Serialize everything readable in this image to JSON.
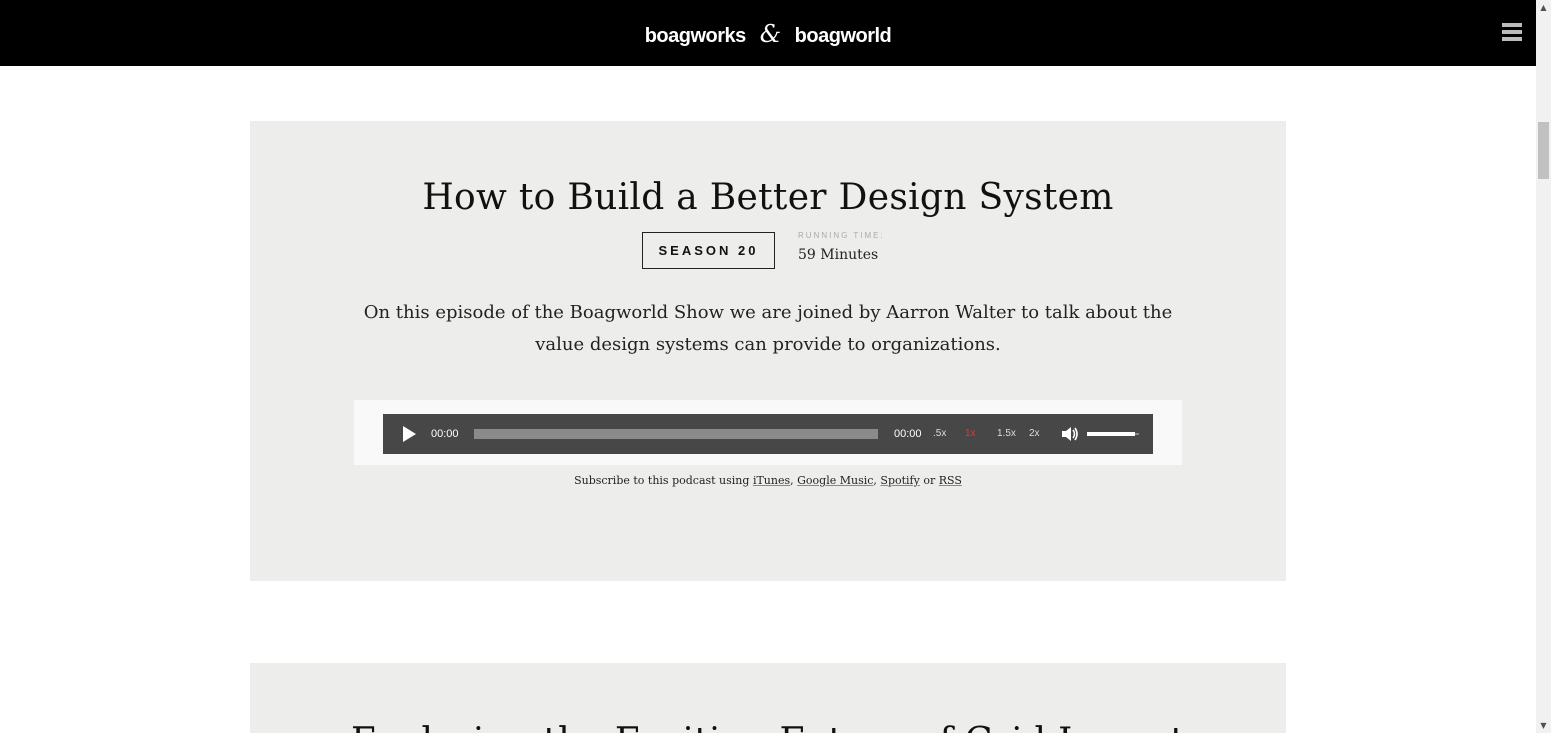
{
  "header": {
    "logo_left": "boagworks",
    "logo_amp": "&",
    "logo_right": "boagworld"
  },
  "episodes": [
    {
      "title": "How to Build a Better Design System",
      "season": "SEASON 20",
      "running_time_label": "RUNNING TIME:",
      "running_time": "59 Minutes",
      "description": "On this episode of the Boagworld Show we are joined by Aarron Walter to talk about the value design systems can provide to organizations.",
      "player": {
        "current_time": "00:00",
        "duration": "00:00",
        "progress": 0,
        "speeds": [
          ".5x",
          "1x",
          "1.5x",
          "2x"
        ],
        "active_speed": "1x"
      },
      "subscribe": {
        "prefix": "Subscribe to this podcast using",
        "itunes": "iTunes",
        "google": "Google Music",
        "spotify": "Spotify",
        "or": "or",
        "rss": "RSS"
      }
    },
    {
      "title": "Exploring the Exciting Future of Grid Layout"
    }
  ],
  "colors": {
    "header_bg": "#000000",
    "card_bg": "#ededeb",
    "player_bg": "#474747",
    "active_speed": "#d93a3a"
  }
}
